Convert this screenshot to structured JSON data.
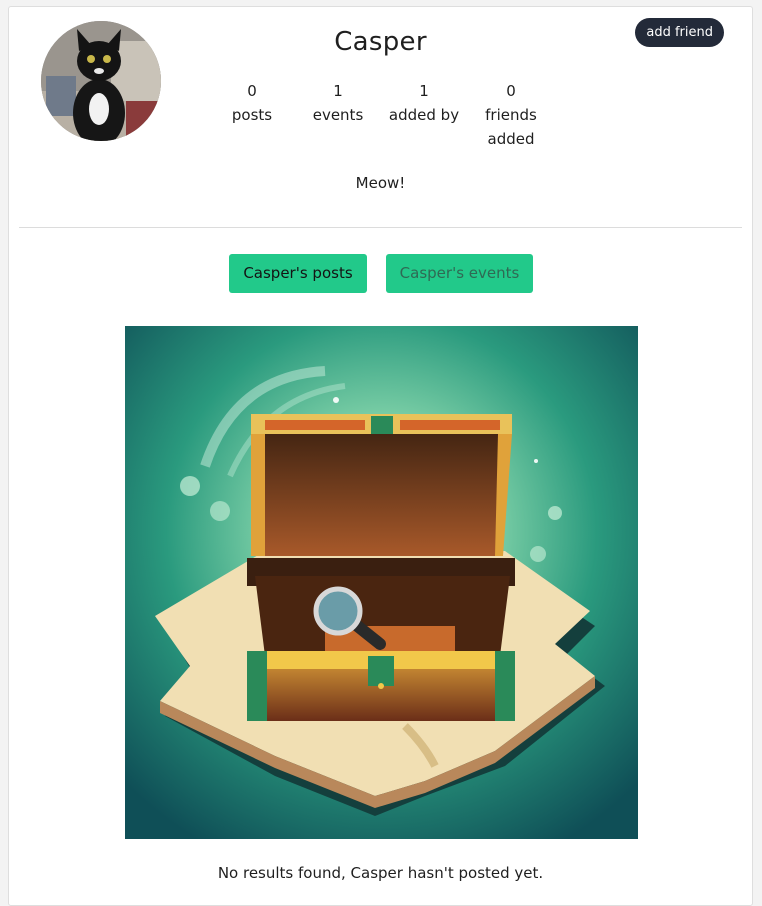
{
  "profile": {
    "name": "Casper",
    "bio": "Meow!",
    "add_friend_label": "add friend"
  },
  "stats": [
    {
      "value": "0",
      "label": "posts"
    },
    {
      "value": "1",
      "label": "events"
    },
    {
      "value": "1",
      "label": "added by"
    },
    {
      "value": "0",
      "label": "friends added"
    }
  ],
  "tabs": [
    {
      "label": "Casper's posts"
    },
    {
      "label": "Casper's events"
    }
  ],
  "empty_state": {
    "message": "No results found, Casper hasn't posted yet."
  },
  "colors": {
    "tab_active": "#22c98a",
    "add_friend_bg": "#232a39"
  }
}
